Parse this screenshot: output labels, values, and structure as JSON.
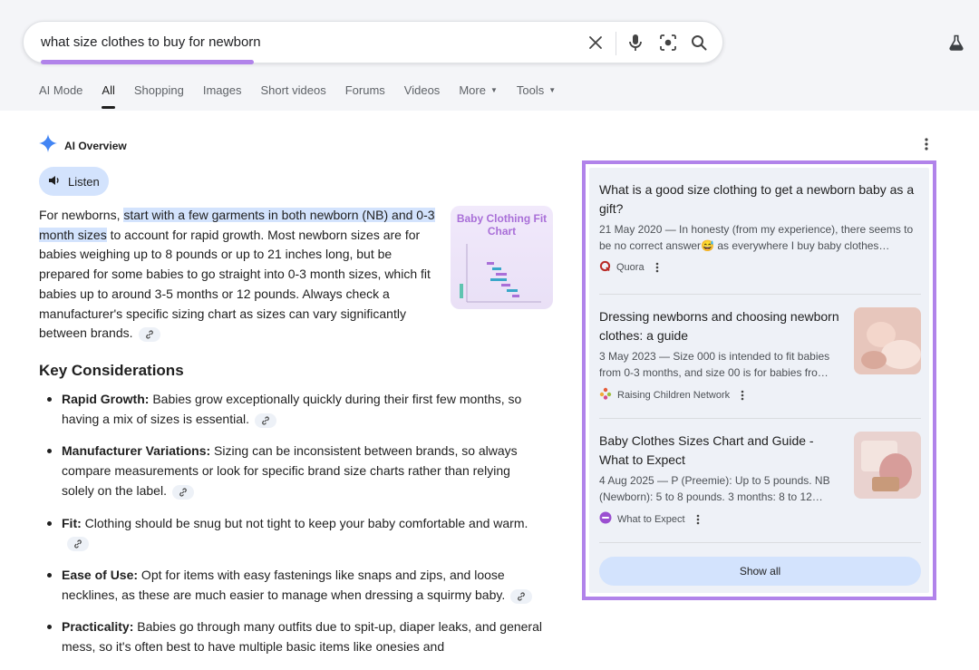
{
  "search": {
    "query": "what size clothes to buy for newborn"
  },
  "tabs": [
    {
      "label": "AI Mode"
    },
    {
      "label": "All"
    },
    {
      "label": "Shopping"
    },
    {
      "label": "Images"
    },
    {
      "label": "Short videos"
    },
    {
      "label": "Forums"
    },
    {
      "label": "Videos"
    },
    {
      "label": "More"
    },
    {
      "label": "Tools"
    }
  ],
  "overview": {
    "title": "AI Overview",
    "listen_label": "Listen",
    "intro_pre": "For newborns, ",
    "intro_highlight": "start with a few garments in both newborn (NB) and 0-3 month sizes",
    "intro_post": " to account for rapid growth. Most newborn sizes are for babies weighing up to 8 pounds or up to 21 inches long, but be prepared for some babies to go straight into 0-3 month sizes, which fit babies up to around 3-5 months or 12 pounds. Always check a manufacturer's specific sizing chart as sizes can vary significantly between brands.",
    "thumb_title": "Baby Clothing Fit Chart",
    "key_title": "Key Considerations",
    "bullets": [
      {
        "term": "Rapid Growth:",
        "text": " Babies grow exceptionally quickly during their first few months, so having a mix of sizes is essential."
      },
      {
        "term": "Manufacturer Variations:",
        "text": " Sizing can be inconsistent between brands, so always compare measurements or look for specific brand size charts rather than relying solely on the label."
      },
      {
        "term": "Fit:",
        "text": " Clothing should be snug but not tight to keep your baby comfortable and warm."
      },
      {
        "term": "Ease of Use:",
        "text": " Opt for items with easy fastenings like snaps and zips, and loose necklines, as these are much easier to manage when dressing a squirmy baby."
      },
      {
        "term": "Practicality:",
        "text": " Babies go through many outfits due to spit-up, diaper leaks, and general mess, so it's often best to have multiple basic items like onesies and"
      }
    ]
  },
  "sources": {
    "items": [
      {
        "title": "What is a good size clothing to get a newborn baby as a gift?",
        "snippet": "21 May 2020 — In honesty (from my experience), there seems to be no correct answer😅 as everywhere I buy baby clothes…",
        "site": "Quora"
      },
      {
        "title": "Dressing newborns and choosing newborn clothes: a guide",
        "snippet": "3 May 2023 — Size 000 is intended to fit babies from 0-3 months, and size 00 is for babies fro…",
        "site": "Raising Children Network"
      },
      {
        "title": "Baby Clothes Sizes Chart and Guide - What to Expect",
        "snippet": "4 Aug 2025 — P (Preemie): Up to 5 pounds. NB (Newborn): 5 to 8 pounds. 3 months: 8 to 12…",
        "site": "What to Expect"
      }
    ],
    "show_all_label": "Show all"
  },
  "colors": {
    "accent": "#b183ea",
    "chip": "#d3e3fd",
    "panel_bg": "#eef1f7"
  }
}
